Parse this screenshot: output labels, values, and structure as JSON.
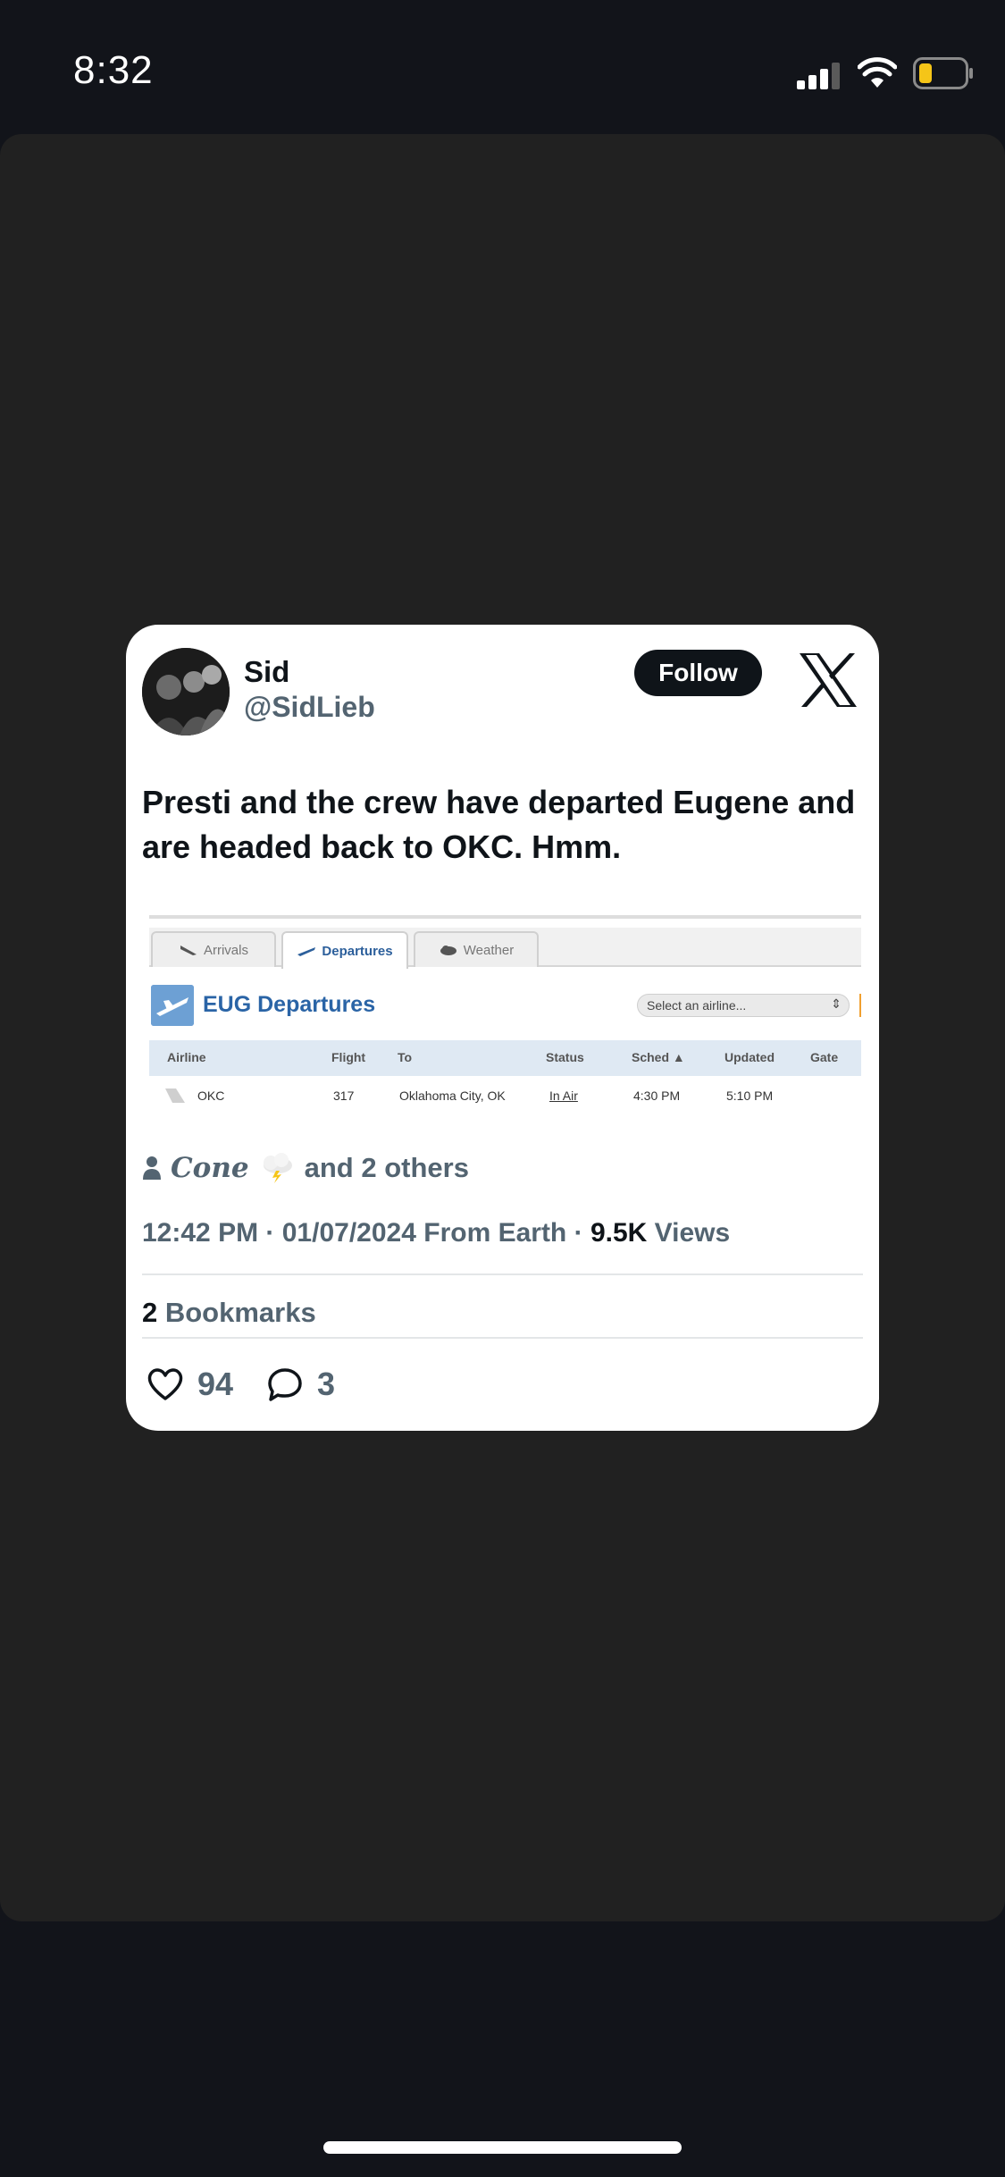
{
  "status_bar": {
    "time": "8:32",
    "icons": [
      "signal-icon",
      "wifi-icon",
      "battery-icon"
    ],
    "battery_color": "#f5c518"
  },
  "tweet": {
    "author_name": "Sid",
    "author_handle": "@SidLieb",
    "follow_label": "Follow",
    "brand_logo": "x-logo",
    "text": "Presti and the crew have departed Eugene and are headed back to OKC. Hmm.",
    "embed": {
      "tabs": [
        {
          "label": "Arrivals",
          "icon": "arrival-plane-icon",
          "active": false
        },
        {
          "label": "Departures",
          "icon": "departure-plane-icon",
          "active": true
        },
        {
          "label": "Weather",
          "icon": "cloud-icon",
          "active": false
        }
      ],
      "title": "EUG Departures",
      "airline_select_placeholder": "Select an airline...",
      "columns": [
        "Airline",
        "Flight",
        "To",
        "Status",
        "Sched ▲",
        "Updated",
        "Gate"
      ],
      "rows": [
        {
          "airline": "OKC",
          "flight": "317",
          "to": "Oklahoma City, OK",
          "status": "In Air",
          "sched": "4:30 PM",
          "updated": "5:10 PM",
          "gate": ""
        }
      ]
    },
    "liked_by": {
      "name": "Cone",
      "rest": "and 2 others"
    },
    "meta": {
      "time": "12:42 PM",
      "sep1": " · ",
      "date": "01/07/2024",
      "location": " From Earth",
      "sep2": " · ",
      "views_count": "9.5K",
      "views_label": " Views"
    },
    "bookmarks": {
      "count": "2",
      "label": " Bookmarks"
    },
    "actions": {
      "likes": "94",
      "replies": "3"
    }
  },
  "colors": {
    "page_bg": "#12141a",
    "sheet_bg": "#212121",
    "card_bg": "#ffffff",
    "text_primary": "#0f1419",
    "text_secondary": "#536471",
    "embed_title": "#2a64a6"
  }
}
